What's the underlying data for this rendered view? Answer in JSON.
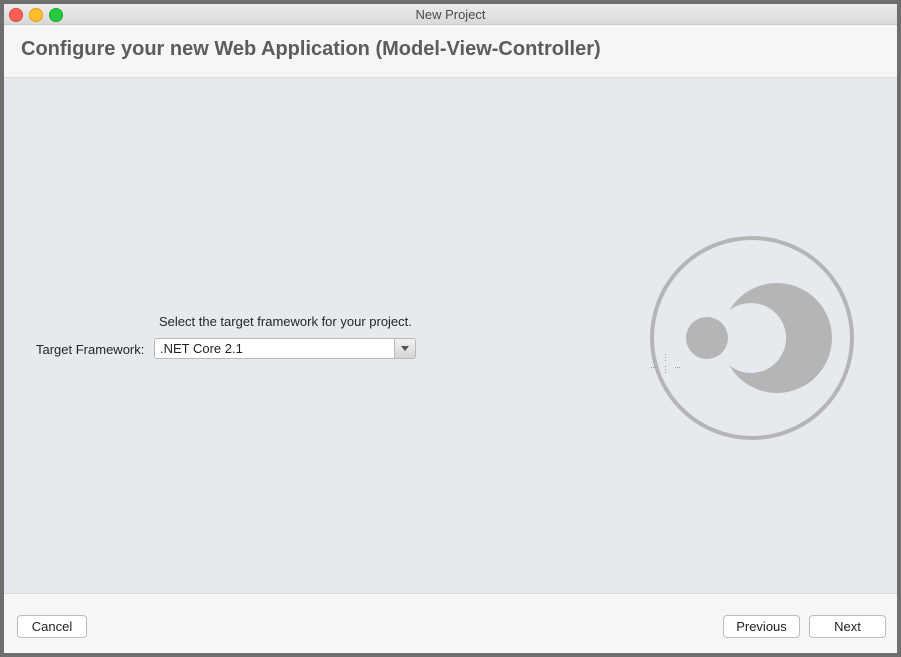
{
  "window": {
    "title": "New Project"
  },
  "header": {
    "title": "Configure your new Web Application (Model-View-Controller)"
  },
  "form": {
    "instruction": "Select the target framework for your project.",
    "framework_label": "Target Framework:",
    "framework_value": ".NET Core 2.1"
  },
  "footer": {
    "cancel_label": "Cancel",
    "previous_label": "Previous",
    "next_label": "Next"
  },
  "icons": {
    "window_controls": [
      "close-icon",
      "minimize-icon",
      "zoom-icon"
    ],
    "dropdown": "chevron-down-icon",
    "illustration": "dotnet-project-logo-icon"
  },
  "colors": {
    "content_background": "#e6e9ed",
    "logo_gray": "#b5b5b5"
  }
}
